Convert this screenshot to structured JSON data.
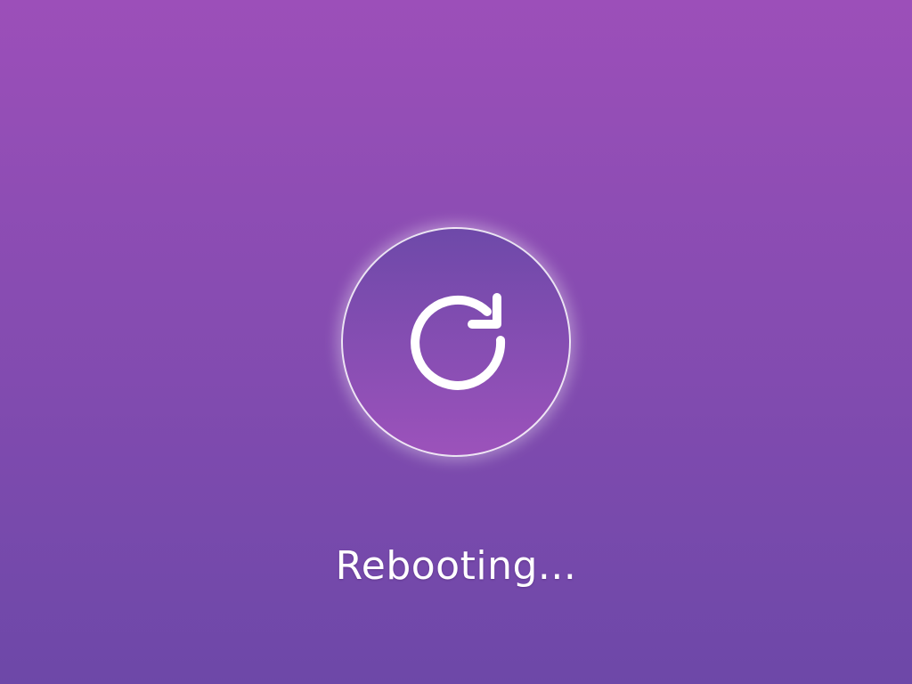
{
  "status": {
    "message": "Rebooting..."
  },
  "icon": {
    "name": "refresh-icon"
  },
  "colors": {
    "background_top": "#9c4fb9",
    "background_bottom": "#6d48a8",
    "circle_top": "#6e49a9",
    "circle_bottom": "#9c52bb",
    "foreground": "#ffffff"
  }
}
